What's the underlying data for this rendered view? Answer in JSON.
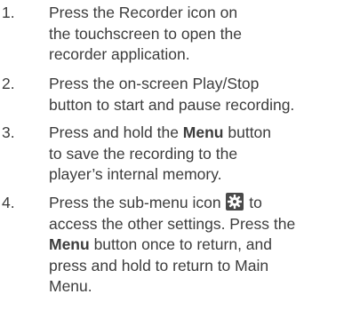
{
  "steps": [
    {
      "number": "1.",
      "lines": [
        "Press the Recorder icon on",
        "the touchscreen to open the",
        "recorder application."
      ]
    },
    {
      "number": "2.",
      "lines": [
        "Press the on-screen Play/Stop",
        "button to start and pause recording."
      ]
    },
    {
      "number": "3.",
      "line1_pre": "Press and hold the ",
      "line1_bold": "Menu",
      "line1_post": " button",
      "lines": [
        "to save the recording to the",
        "player’s internal memory."
      ]
    },
    {
      "number": "4.",
      "line1_pre": "Press the sub-menu icon ",
      "line1_post": " to",
      "line2": "access the other settings. Press the",
      "line3_bold": "Menu",
      "line3_post": " button once to return, and",
      "line4": "press and hold to return to Main",
      "line5": "Menu."
    }
  ]
}
